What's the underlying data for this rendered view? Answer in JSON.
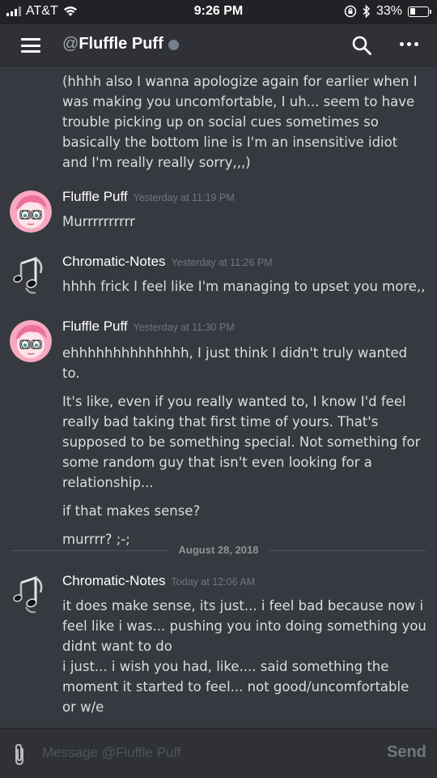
{
  "status_bar": {
    "carrier": "AT&T",
    "time": "9:26 PM",
    "battery": "33%",
    "battery_level": 0.33,
    "icons": [
      "signal-icon",
      "wifi-icon",
      "rotation-lock-icon",
      "bluetooth-icon",
      "battery-icon"
    ]
  },
  "header": {
    "at_symbol": "@",
    "channel_name": "Fluffle Puff",
    "icons": [
      "hamburger-menu-icon",
      "search-icon",
      "more-options-icon"
    ],
    "presence_color": "#747f8d"
  },
  "messages": {
    "continued": {
      "text": "(hhhh also I wanna apologize again for earlier when I was making you uncomfortable, I uh... seem to have trouble picking up on social cues sometimes so basically the bottom line is I'm an insensitive idiot and I'm really really sorry,,,)"
    },
    "groups": [
      {
        "author": "Fluffle Puff",
        "timestamp": "Yesterday at 11:19 PM",
        "avatar": "pink-hair-avatar",
        "paragraphs": [
          "Murrrrrrrrrr"
        ]
      },
      {
        "author": "Chromatic-Notes",
        "timestamp": "Yesterday at 11:26 PM",
        "avatar": "music-notes-avatar",
        "paragraphs": [
          "hhhh frick I feel like I'm managing to upset you more,,"
        ]
      },
      {
        "author": "Fluffle Puff",
        "timestamp": "Yesterday at 11:30 PM",
        "avatar": "pink-hair-avatar",
        "paragraphs": [
          "ehhhhhhhhhhhhhh, I just think I didn't truly wanted to.",
          "It's like, even if you really wanted to, I know I'd feel really bad taking that first time of yours. That's supposed to be something special. Not something for some random guy that isn't even looking for a relationship...",
          "if that makes sense?",
          "murrrr? ;-;"
        ]
      }
    ],
    "date_divider": "August 28, 2018",
    "last_group": {
      "author": "Chromatic-Notes",
      "timestamp": "Today at 12:06 AM",
      "avatar": "music-notes-avatar",
      "lines": [
        "it does make sense, its just... i feel bad because now i feel like i was... pushing you into doing something you didnt want to do",
        "i just... i wish you had, like.... said something the moment it started to feel... not good/uncomfortable or w/e"
      ]
    }
  },
  "composer": {
    "placeholder": "Message @Fluffle Puff",
    "send_label": "Send",
    "attach_icon": "paperclip-icon"
  },
  "colors": {
    "background": "#36393f",
    "header": "#2f3136",
    "status_bar": "#202225",
    "text": "#dcddde",
    "timestamp": "#72767d"
  }
}
